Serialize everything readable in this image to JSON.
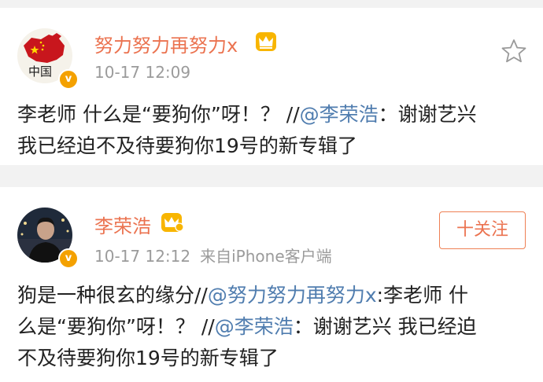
{
  "post1": {
    "username": "努力努力再努力x",
    "timestamp": "10-17 12:09",
    "avatar_text": "中国",
    "verified_badge": "v",
    "body": {
      "part1": "李老师 什么是“要狗你”呀！？ //",
      "mention": "@李荣浩",
      "part2": "：谢谢艺兴",
      "line2": "我已经迫不及待要狗你19号的新专辑了"
    },
    "favorite_icon": "star-outline-icon"
  },
  "post2": {
    "username": "李荣浩",
    "timestamp": "10-17 12:12",
    "source": "来自iPhone客户端",
    "verified_badge": "v",
    "follow_label": "十关注",
    "body": {
      "seg1": "狗是一种很玄的缘分//",
      "mention1": "@努力努力再努力x",
      "seg2": ":李老师 什",
      "seg3": "么是“要狗你”呀！？ //",
      "mention2": "@李荣浩",
      "seg4": "：谢谢艺兴 我已经迫",
      "seg5": "不及待要狗你19号的新专辑了"
    }
  },
  "colors": {
    "username": "#eb7350",
    "mention": "#507daf",
    "meta": "#9b9b9b",
    "background": "#f2f2f2",
    "badge": "#f4a100"
  }
}
